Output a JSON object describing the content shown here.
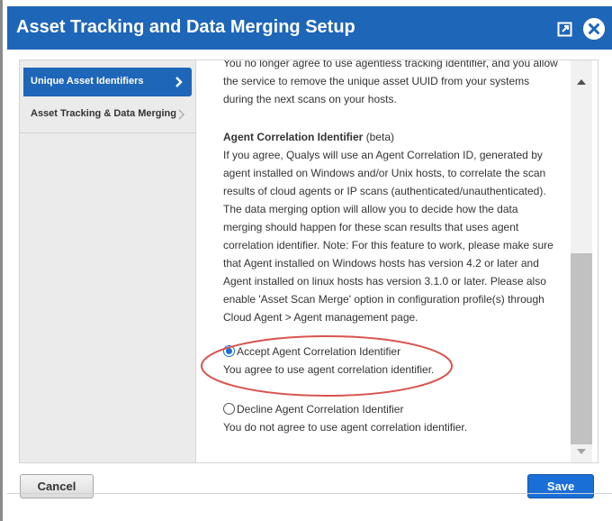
{
  "dialog": {
    "title": "Asset Tracking and Data Merging Setup"
  },
  "sidebar": {
    "items": [
      {
        "label": "Unique Asset Identifiers",
        "active": true
      },
      {
        "label": "Asset Tracking & Data Merging",
        "active": false
      }
    ]
  },
  "content": {
    "intro_lines": [
      "You no longer agree to use agentless tracking identifier, and you allow",
      "the service to remove the unique asset UUID from your systems",
      "during the next scans on your hosts."
    ],
    "section_title": "Agent Correlation Identifier",
    "section_title_suffix": "(beta)",
    "description_lines": [
      "If you agree, Qualys will use an Agent Correlation ID, generated by",
      "agent installed on Windows and/or Unix hosts, to correlate the scan",
      "results of cloud agents or IP scans (authenticated/unauthenticated).",
      "The data merging option will allow you to decide how the data",
      "merging should happen for these scan results that uses agent",
      "correlation identifier. Note: For this feature to work, please make sure",
      "that Agent installed on Windows hosts has version 4.2 or later and",
      "Agent installed on linux hosts has version 3.1.0 or later. Please also",
      "enable 'Asset Scan Merge' option in configuration profile(s) through",
      "Cloud Agent > Agent management page."
    ],
    "options": [
      {
        "label": "Accept Agent Correlation Identifier",
        "description": "You agree to use agent correlation identifier.",
        "selected": true
      },
      {
        "label": "Decline Agent Correlation Identifier",
        "description": "You do not agree to use agent correlation identifier.",
        "selected": false
      }
    ]
  },
  "footer": {
    "cancel_label": "Cancel",
    "save_label": "Save"
  },
  "colors": {
    "title_bar": "#1e66b8",
    "primary_button": "#1a6fd6",
    "highlight_annotation": "#d9534f"
  }
}
